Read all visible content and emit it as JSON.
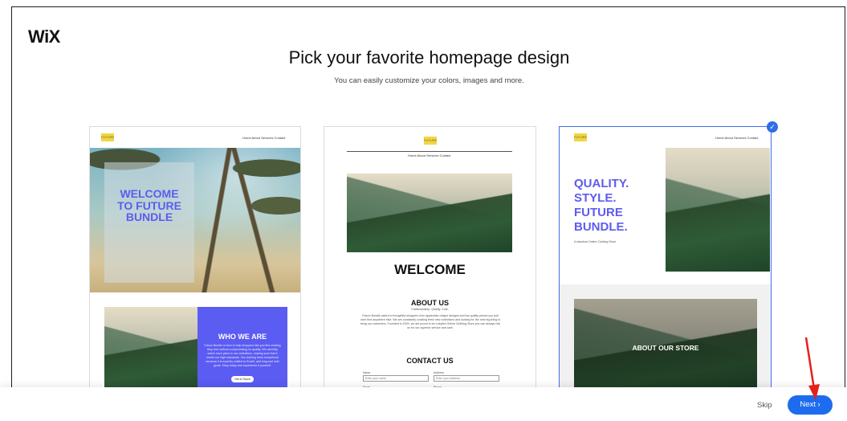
{
  "brand": {
    "logo": "WiX"
  },
  "header": {
    "title": "Pick your favorite homepage design",
    "subtitle": "You can easily customize your colors, images and more."
  },
  "designs": [
    {
      "logo_text": "FUTURE",
      "nav": "Home  About  Services  Contact",
      "hero_text": "WELCOME TO FUTURE BUNDLE",
      "section_title": "WHO WE ARE",
      "section_body": "Future Bundle is here to help shoppers like you find clothing they love without compromising on quality. We carefully select each piece in our collections, making sure that it meets our high standards. Our clothing feels exceptional because it is expertly crafted to fit well, and long and hold great. Shop today and experience it yourself.",
      "cta": "Get in Touch"
    },
    {
      "logo_text": "FUTURE",
      "nav": "Home  About  Services  Contact",
      "hero_text": "WELCOME",
      "about_title": "ABOUT US",
      "about_sub": "Craftsmanship. Quality. Care.",
      "about_body": "Future Bundle caters to thoughtful shoppers who appreciate unique designs and top quality pieces you just can't find anywhere else. We are constantly curating fresh new collections and looking for the next big thing to bring our customers. Founded in 2020, we are proud to be a stylish Online Clothing Store you can always rely on for our superior service and care.",
      "contact_title": "CONTACT US",
      "fields": [
        {
          "label": "Name",
          "placeholder": "Enter your name"
        },
        {
          "label": "Address",
          "placeholder": "Enter your address"
        },
        {
          "label": "Email",
          "placeholder": "Enter your email"
        },
        {
          "label": "Phone",
          "placeholder": "Enter your phone number"
        }
      ]
    },
    {
      "logo_text": "FUTURE",
      "nav": "Home  About  Services  Contact",
      "hero_lines": [
        "QUALITY.",
        "STYLE.",
        "FUTURE",
        "BUNDLE."
      ],
      "tagline": "A standout Online Clothing Store",
      "store_label": "ABOUT OUR STORE",
      "selected": true
    }
  ],
  "footer": {
    "skip": "Skip",
    "next": "Next ›"
  },
  "colors": {
    "accent": "#1d6cf0",
    "template_purple": "#5b5cf2",
    "annotation_arrow": "#e3211c"
  }
}
